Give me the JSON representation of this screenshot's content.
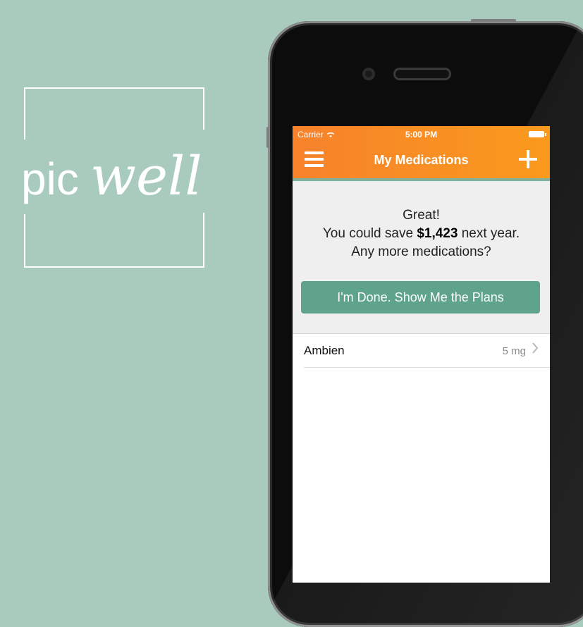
{
  "logo": {
    "text": "picwell",
    "prefix": "pic",
    "suffix": "well"
  },
  "status_bar": {
    "carrier": "Carrier",
    "time": "5:00 PM"
  },
  "nav": {
    "title": "My Medications",
    "menu_icon": "hamburger-menu-icon",
    "add_icon": "plus-icon"
  },
  "summary": {
    "line1": "Great!",
    "line2_prefix": "You could save ",
    "savings": "$1,423",
    "line2_suffix": " next year.",
    "line3": "Any more medications?"
  },
  "done_button": {
    "label": "I'm Done. Show Me the Plans"
  },
  "medications": [
    {
      "name": "Ambien",
      "dose": "5 mg"
    }
  ],
  "colors": {
    "background": "#a8cbbd",
    "nav_start": "#f7822b",
    "nav_end": "#fa9a1d",
    "button": "#5fa38c"
  }
}
